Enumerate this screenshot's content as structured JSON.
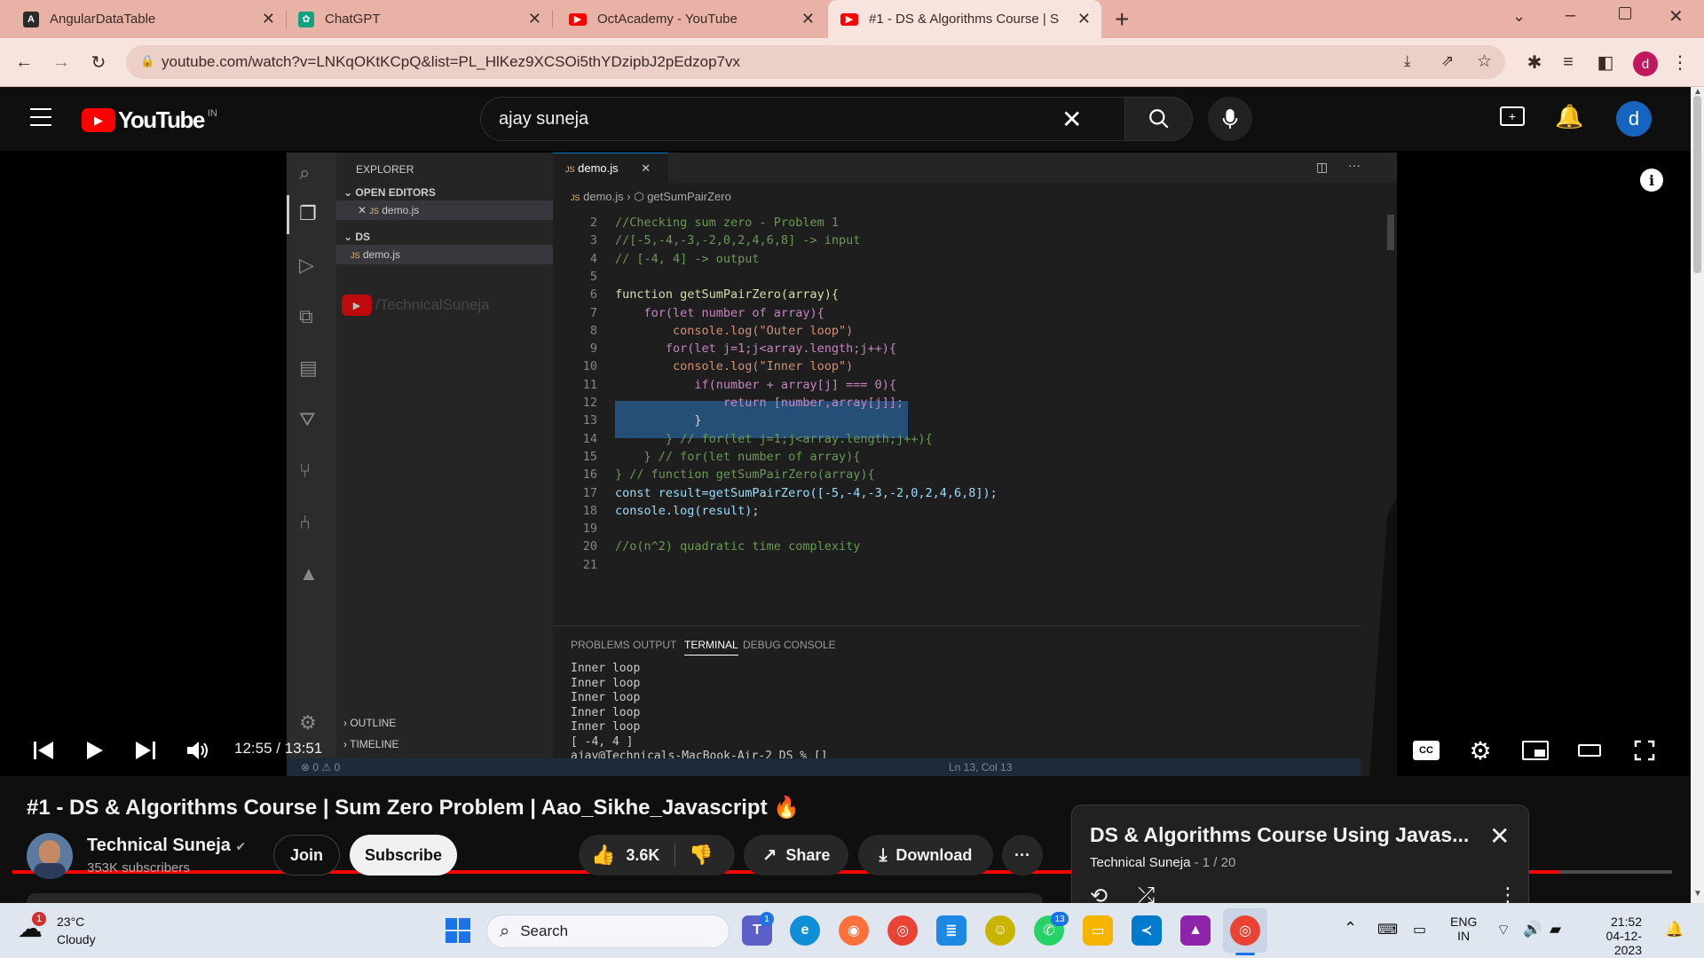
{
  "browser": {
    "tabs": [
      {
        "label": "AngularDataTable",
        "icon": "angular-icon",
        "color": "#2b2b2b"
      },
      {
        "label": "ChatGPT",
        "icon": "chatgpt-icon",
        "color": "#10a37f"
      },
      {
        "label": "OctAcademy - YouTube",
        "icon": "youtube-icon",
        "color": "#ff0000"
      },
      {
        "label": "#1 - DS & Algorithms Course | S",
        "icon": "youtube-icon",
        "color": "#ff0000",
        "active": true
      }
    ],
    "new_tab": "+",
    "url": "youtube.com/watch?v=LNKqOKtKCpQ&list=PL_HlKez9XCSOi5thYDzipbJ2pEdzop7vx",
    "profile_initial": "d"
  },
  "youtube": {
    "logo_text": "YouTube",
    "country": "IN",
    "search_value": "ajay suneja",
    "avatar_initial": "d"
  },
  "video": {
    "time_current": "12:55",
    "time_sep": " / ",
    "time_total": "13:51",
    "progress": 0.932,
    "vscode": {
      "explorer_label": "EXPLORER",
      "open_editors": "OPEN EDITORS",
      "open_file": "demo.js",
      "folder": "DS",
      "folder_file": "demo.js",
      "watermark": "/TechnicalSuneja",
      "outline": "OUTLINE",
      "timeline": "TIMELINE",
      "tab_file": "demo.js",
      "breadcrumb_file": "demo.js",
      "breadcrumb_fn": "getSumPairZero",
      "code_lines": [
        {
          "n": "2",
          "t": "//Checking sum zero - Problem 1",
          "c": "#6a9955"
        },
        {
          "n": "3",
          "t": "//[-5,-4,-3,-2,0,2,4,6,8] -> input",
          "c": "#6a9955"
        },
        {
          "n": "4",
          "t": "// [-4, 4] -> output",
          "c": "#6a9955"
        },
        {
          "n": "5",
          "t": "",
          "c": "#d4d4d4"
        },
        {
          "n": "6",
          "t": "function getSumPairZero(array){",
          "c": "#dcdcaa"
        },
        {
          "n": "7",
          "t": "    for(let number of array){",
          "c": "#c586c0"
        },
        {
          "n": "8",
          "t": "        console.log(\"Outer loop\")",
          "c": "#ce9178"
        },
        {
          "n": "9",
          "t": "       for(let j=1;j<array.length;j++){",
          "c": "#c586c0"
        },
        {
          "n": "10",
          "t": "        console.log(\"Inner loop\")",
          "c": "#ce9178"
        },
        {
          "n": "11",
          "t": "           if(number + array[j] === 0){",
          "c": "#c586c0"
        },
        {
          "n": "12",
          "t": "               return [number,array[j]];",
          "c": "#c586c0"
        },
        {
          "n": "13",
          "t": "           }",
          "c": "#d4d4d4"
        },
        {
          "n": "14",
          "t": "       } // for(let j=1;j<array.length;j++){",
          "c": "#6a9955"
        },
        {
          "n": "15",
          "t": "    } // for(let number of array){",
          "c": "#6a9955"
        },
        {
          "n": "16",
          "t": "} // function getSumPairZero(array){",
          "c": "#6a9955"
        },
        {
          "n": "17",
          "t": "const result=getSumPairZero([-5,-4,-3,-2,0,2,4,6,8]);",
          "c": "#9cdcfe"
        },
        {
          "n": "18",
          "t": "console.log(result);",
          "c": "#9cdcfe"
        },
        {
          "n": "19",
          "t": "",
          "c": "#d4d4d4"
        },
        {
          "n": "20",
          "t": "//o(n^2) quadratic time complexity",
          "c": "#6a9955"
        },
        {
          "n": "21",
          "t": "",
          "c": "#d4d4d4"
        }
      ],
      "panel_tabs": [
        "PROBLEMS",
        "OUTPUT",
        "TERMINAL",
        "DEBUG CONSOLE"
      ],
      "terminal_lines": [
        "Inner loop",
        "Inner loop",
        "Inner loop",
        "Inner loop",
        "Inner loop",
        "[ -4, 4 ]",
        "ajay@Technicals-MacBook-Air-2 DS % []"
      ],
      "status_left": "⊗ 0 ⚠ 0",
      "status_right": "Ln 13, Col 13"
    }
  },
  "details": {
    "title": "#1 - DS & Algorithms Course | Sum Zero Problem | Aao_Sikhe_Javascript 🔥",
    "channel": "Technical Suneja",
    "subscribers": "353K subscribers",
    "join": "Join",
    "subscribe": "Subscribe",
    "likes": "3.6K",
    "share": "Share",
    "download": "Download"
  },
  "playlist": {
    "title": "DS & Algorithms Course Using Javas...",
    "channel": "Technical Suneja",
    "position": "- 1 / 20"
  },
  "taskbar": {
    "weather_temp": "23°C",
    "weather_desc": "Cloudy",
    "weather_badge": "1",
    "search": "Search",
    "teams_badge": "1",
    "whatsapp_badge": "13",
    "lang1": "ENG",
    "lang2": "IN",
    "time": "21:52",
    "date": "04-12-2023"
  }
}
